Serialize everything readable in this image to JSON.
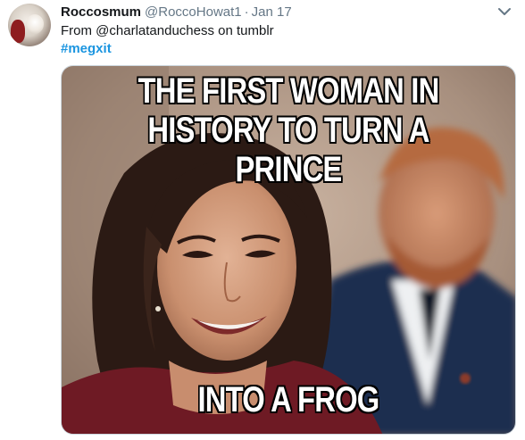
{
  "tweet": {
    "display_name": "Roccosmum",
    "handle": "@RoccoHowat1",
    "separator": "·",
    "date": "Jan 17",
    "text": "From @charlatanduchess on tumblr",
    "hashtag": "#megxit"
  },
  "media": {
    "top_caption_line1": "THE FIRST WOMAN IN",
    "top_caption_line2": "HISTORY TO TURN A PRINCE",
    "bottom_caption": "INTO A FROG"
  },
  "icons": {
    "menu": "chevron-down-icon",
    "avatar": "profile-avatar"
  },
  "colors": {
    "link": "#1b95e0",
    "secondary_text": "#657786",
    "primary_text": "#14171a"
  }
}
